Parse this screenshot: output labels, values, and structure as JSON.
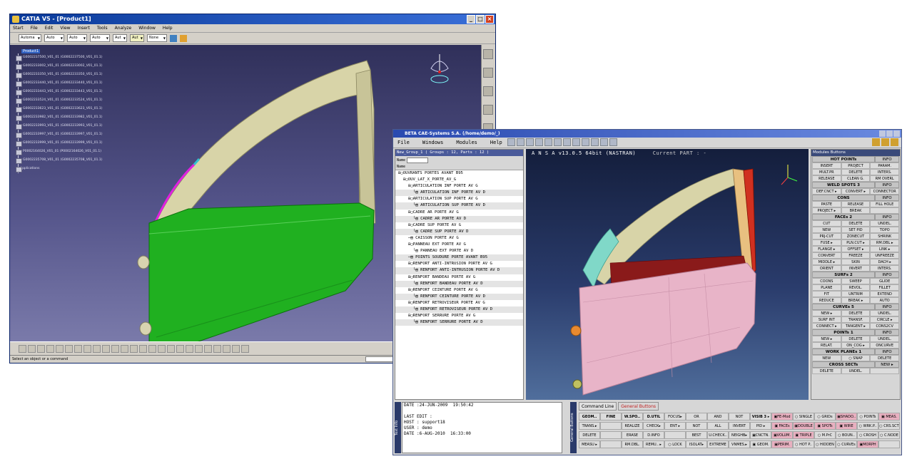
{
  "catia": {
    "title": "CATIA V5 - [Product1]",
    "menu": [
      "Start",
      "File",
      "Edit",
      "View",
      "Insert",
      "Tools",
      "Analyze",
      "Window",
      "Help"
    ],
    "combos": [
      "Automa",
      "Auto",
      "Auto",
      "Auto",
      "Aut",
      "Aut",
      "None"
    ],
    "tree_root": "Product1",
    "tree_nodes": [
      "G0002237500_V01_01 (G0002237500_V01_01.1)",
      "G0002233002_V01_01 (G0002233002_V01_01.1)",
      "G0002233350_V01_01 (G0002233350_V01_01.1)",
      "G0002233440_V01_01 (G0002233440_V01_01.1)",
      "G0002233443_V01_01 (G0002233443_V01_01.1)",
      "G0002233524_V01_01 (G0002233524_V01_01.1)",
      "G0002233623_V01_01 (G0002233623_V01_01.1)",
      "G0002233982_V01_01 (G0002233982_V01_01.1)",
      "G0002233993_V01_01 (G0002233993_V01_01.1)",
      "G0002233997_V01_01 (G0002233997_V01_01.1)",
      "G0002233999_V01_01 (G0002233999_V01_01.1)",
      "P0002164026_V01_01 (P0002164026_V01_01.1)",
      "G0002235708_V01_01 (G0002235708_V01_01.1)"
    ],
    "tree_last": "Applications",
    "status": "Select an object or a command"
  },
  "ansa": {
    "title": "BETA CAE-Systems S.A. (/home/demo/_)",
    "menu": [
      "File",
      "Windows",
      "Modules",
      "Help"
    ],
    "viewport_title_a": "A N S A v13.0.5 64bit (NASTRAN)",
    "viewport_title_b": "Current PART : -",
    "lp_header": "New_Group_1 ( Groups : 12, Parts : 12 )",
    "lp_name_label": "Name",
    "lp_name_header": "Name",
    "tree": [
      {
        "indent": 0,
        "text": "⊟▢OUVRANTS PORTES AVANT B95",
        "leaf": false
      },
      {
        "indent": 1,
        "text": "⊟▢OUV_LAT_X_PORTE_AV_G",
        "leaf": false
      },
      {
        "indent": 2,
        "text": "⊟▢ARTICULATION INF PORTE AV G",
        "leaf": false
      },
      {
        "indent": 3,
        "text": "└▤ ARTICULATION INF PORTE AV D",
        "leaf": true
      },
      {
        "indent": 2,
        "text": "⊟▢ARTICULATION SUP PORTE AV G",
        "leaf": false
      },
      {
        "indent": 3,
        "text": "└▤ ARTICULATION SUP PORTE AV D",
        "leaf": true
      },
      {
        "indent": 2,
        "text": "⊟▢CADRE AR PORTE AV G",
        "leaf": false
      },
      {
        "indent": 3,
        "text": "└▤ CADRE AR PORTE AV D",
        "leaf": true
      },
      {
        "indent": 2,
        "text": "⊟▢CADRE SUP PORTE AV G",
        "leaf": false
      },
      {
        "indent": 3,
        "text": "└▤ CADRE SUP PORTE AV D",
        "leaf": true
      },
      {
        "indent": 2,
        "text": "─▤ CAISSON PORTE AV G",
        "leaf": false
      },
      {
        "indent": 2,
        "text": "⊟▢PANNEAU EXT PORTE AV G",
        "leaf": false
      },
      {
        "indent": 3,
        "text": "└▤ PANNEAU EXT PORTE AV D",
        "leaf": false
      },
      {
        "indent": 2,
        "text": "─▤ POINTS SOUDURE PORTE AVANT B95",
        "leaf": true
      },
      {
        "indent": 2,
        "text": "⊟▢RENFORT ANTI-INTRUSION PORTE AV G",
        "leaf": false
      },
      {
        "indent": 3,
        "text": "└▤ RENFORT ANTI-INTRUSION PORTE AV D",
        "leaf": true
      },
      {
        "indent": 2,
        "text": "⊟▢RENFORT BANDEAU PORTE AV G",
        "leaf": false
      },
      {
        "indent": 3,
        "text": "└▤ RENFORT BANDEAU PORTE AV D",
        "leaf": true
      },
      {
        "indent": 2,
        "text": "⊟▢RENFORT CEINTURE PORTE AV G",
        "leaf": false
      },
      {
        "indent": 3,
        "text": "└▤ RENFORT CEINTURE PORTE AV D",
        "leaf": true
      },
      {
        "indent": 2,
        "text": "⊟▢RENFORT RETROVISEUR PORTE AV G",
        "leaf": false
      },
      {
        "indent": 3,
        "text": "└▤ RENFORT RETROVISEUR PORTE AV D",
        "leaf": true
      },
      {
        "indent": 2,
        "text": "⊟▢RENFORT SERRURE PORTE AV G",
        "leaf": false
      },
      {
        "indent": 3,
        "text": "└▤ RENFORT SERRURE PORTE AV D",
        "leaf": true
      }
    ],
    "rp_header": "Modules Buttons",
    "groups": [
      {
        "title": "HOT POINTs",
        "info": "INFO",
        "rows": [
          [
            "INSERT",
            "PROJECT",
            "PARAM."
          ],
          [
            "MULT.PR",
            "DELETE",
            "INTERS."
          ],
          [
            "RELEASE",
            "CLEAN G.",
            "RM OVERL"
          ]
        ]
      },
      {
        "title": "WELD SPOTS 3",
        "info": "INFO",
        "rows": [
          [
            "DEF.CNCT ▸",
            "CONVERT ▸",
            "CONNECTOR"
          ]
        ]
      },
      {
        "title": "CONS",
        "info": "INFO",
        "rows": [
          [
            "PASTE",
            "RELEASE",
            "FILL HOLE"
          ],
          [
            "PROJECT ▸",
            "BREAK",
            ""
          ]
        ]
      },
      {
        "title": "FACEs 2",
        "info": "INFO",
        "rows": [
          [
            "CUT",
            "DELETE",
            "UNDEL."
          ],
          [
            "NEW",
            "SET PID",
            "TOPO"
          ],
          [
            "PRJ-CUT",
            "ZONECUT",
            "SHRINK"
          ],
          [
            "FUSE ▸",
            "PLN.CUT ▸",
            "RM.DBL ▸"
          ],
          [
            "FLANGE ▸",
            "OFFSET ▸",
            "LINK ▸"
          ],
          [
            "CONVERT",
            "FREEZE",
            "UNFREEZE"
          ],
          [
            "MIDDLE ▸",
            "SKIN",
            "DACH ▸"
          ],
          [
            "ORIENT",
            "INVERT",
            "INTERS."
          ]
        ]
      },
      {
        "title": "SURFs 2",
        "info": "INFO",
        "rows": [
          [
            "COONS",
            "SWEEP",
            "GLIDE"
          ],
          [
            "PLANE",
            "REVOL.",
            "FILLET"
          ],
          [
            "FIT",
            "UNTRIM",
            "EXTEND"
          ],
          [
            "REDUCE",
            "BREAK ▸",
            "AUTO"
          ]
        ]
      },
      {
        "title": "CURVEs 5",
        "info": "INFO",
        "rows": [
          [
            "NEW ▸",
            "DELETE",
            "UNDEL."
          ],
          [
            "SURF INT",
            "TRANSF.",
            "CIRCLE ▸"
          ],
          [
            "CONNECT ▸",
            "TANGENT ▸",
            "CONS2CV"
          ]
        ]
      },
      {
        "title": "POINTs 1",
        "info": "INFO",
        "rows": [
          [
            "NEW ▸",
            "DELETE",
            "UNDEL."
          ],
          [
            "RELAT.",
            "ON_COG ▸",
            "ONCURVE"
          ]
        ]
      },
      {
        "title": "WORK PLANEs 1",
        "info": "INFO",
        "rows": [
          [
            "NEW",
            "○ SNAP",
            "DELETE"
          ]
        ]
      },
      {
        "title": "CROSS SECTs",
        "info": "NEW ▸",
        "rows": [
          [
            "DELETE",
            "UNDEL.",
            ""
          ]
        ]
      }
    ],
    "cmd_label": "Text Info",
    "cmd_text": "DATE :24-JUN-2009  19:50:42\n\nLAST EDIT :\nHOST : support18\nUSER : demo\nDATE :6-AUG-2010  16:33:00",
    "gen_label": "General Buttons",
    "tabs": [
      "Command Line",
      "General Buttons"
    ],
    "gen_rows": [
      [
        "GEOM..",
        "FINE",
        "W.SPO..",
        "D.UTIL",
        "FOCUS▸",
        "OR",
        "AND",
        "NOT",
        "VISIB 3 ▸",
        "▣FE-Mod",
        "○ SINGLE",
        "○ GRIDs",
        "▣SHADO..",
        "○ POINTs",
        "▣ MEAS."
      ],
      [
        "TRANS.▸",
        "",
        "REALIZE",
        "CHECK▸",
        "ENT ▸",
        "NOT",
        "ALL",
        "INVERT",
        "PID ▸",
        "▣ FACEs",
        "▣DOUBLE",
        "▣ SPOTs",
        "▣ WIRE",
        "○ WRK.P..",
        "○ CRS.SCT"
      ],
      [
        "DELETE",
        "",
        "ERASE",
        "D.INFO",
        "",
        "BEST",
        "U.CHECK..",
        "NEIGHB▸",
        "▣CNCTN.",
        "▣VOLUM.",
        "▣ TRIPLE",
        "○ M.PrC",
        "○ BOUN..",
        "○ CROSH",
        "○ C.NODE"
      ],
      [
        "MEASU ▸",
        "",
        "RM.DBL.",
        "REMU.. ▸",
        "○ LOCK",
        "ISOLAT▸",
        "EXTREME",
        "VNMES.▸",
        "▣ GEOM.",
        "▣PERIM.",
        "○ HOT P..",
        "○ HIDDEN",
        "○ CURVEs",
        "▣MORPH",
        ""
      ]
    ]
  }
}
